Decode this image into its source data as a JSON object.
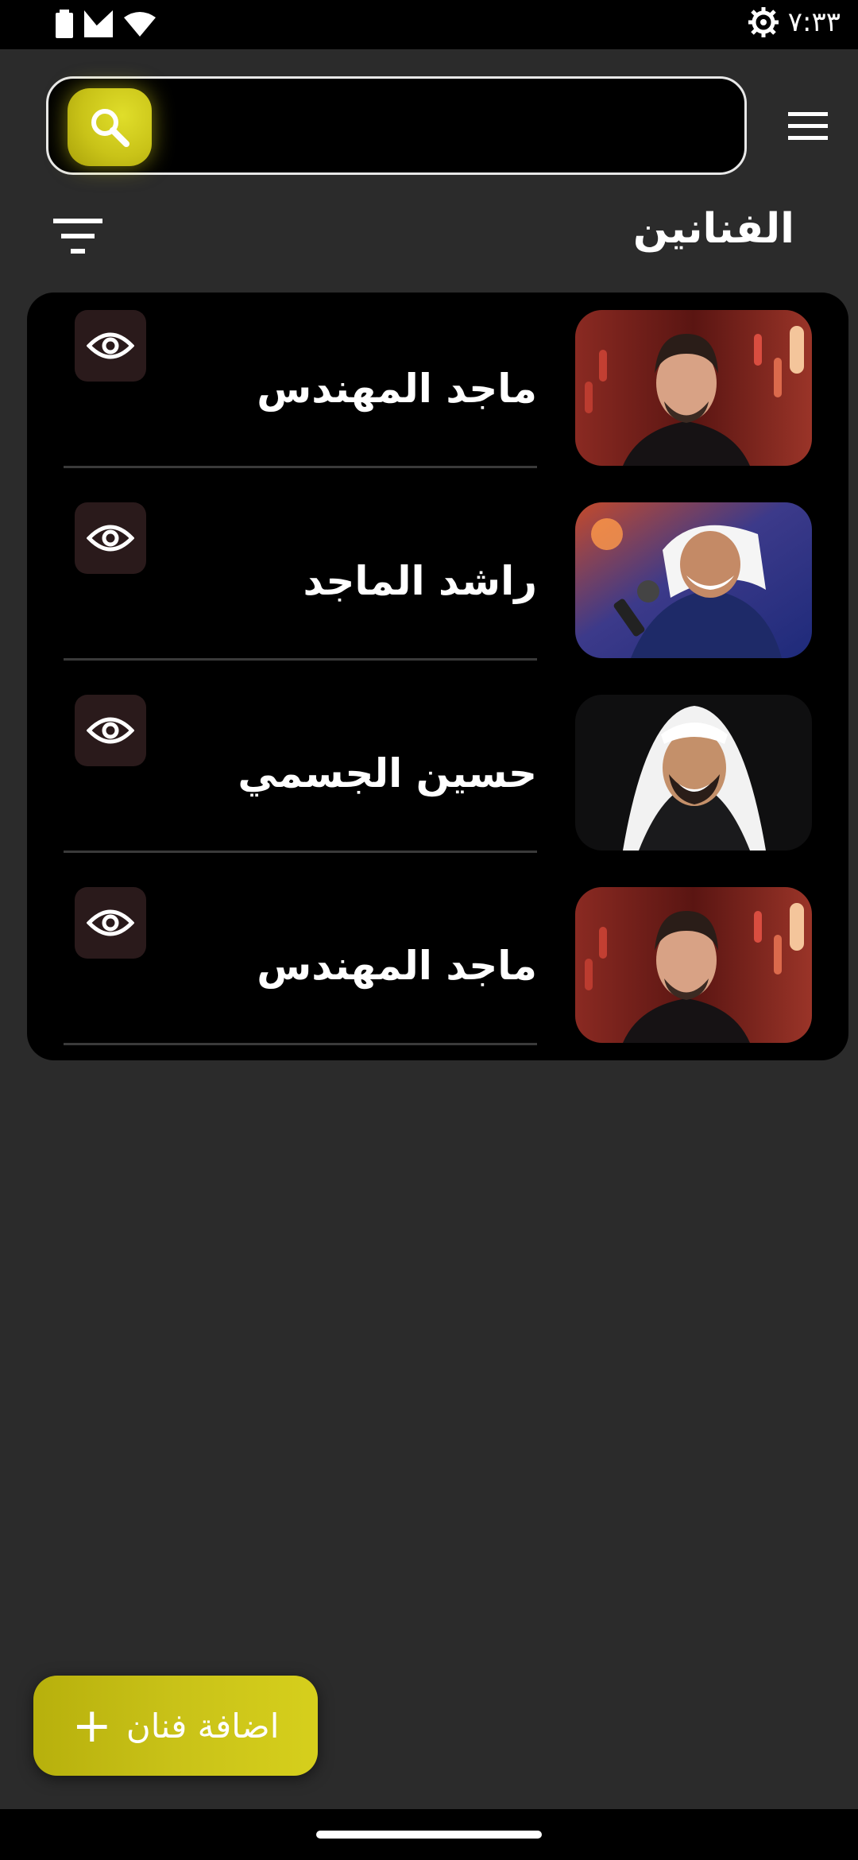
{
  "status_bar": {
    "time": "٧:٣٣",
    "icons": [
      "settings-gear-icon",
      "wifi-icon",
      "signal-icon",
      "battery-icon"
    ]
  },
  "search": {
    "placeholder": "",
    "icon": "search-icon",
    "accent_color": "#c9c318"
  },
  "header": {
    "title": "الفنانين",
    "menu_icon": "hamburger-menu-icon",
    "filter_icon": "filter-icon"
  },
  "artists": [
    {
      "name": "ماجد المهندس",
      "photo": "artist-photo-majid",
      "action_icon": "eye-icon"
    },
    {
      "name": "راشد الماجد",
      "photo": "artist-photo-rashed",
      "action_icon": "eye-icon"
    },
    {
      "name": "حسين الجسمي",
      "photo": "artist-photo-hussain",
      "action_icon": "eye-icon"
    },
    {
      "name": "ماجد المهندس",
      "photo": "artist-photo-majid",
      "action_icon": "eye-icon"
    }
  ],
  "add_artist": {
    "label": "اضافة فنان",
    "plus": "+",
    "color": "#c9c218"
  }
}
